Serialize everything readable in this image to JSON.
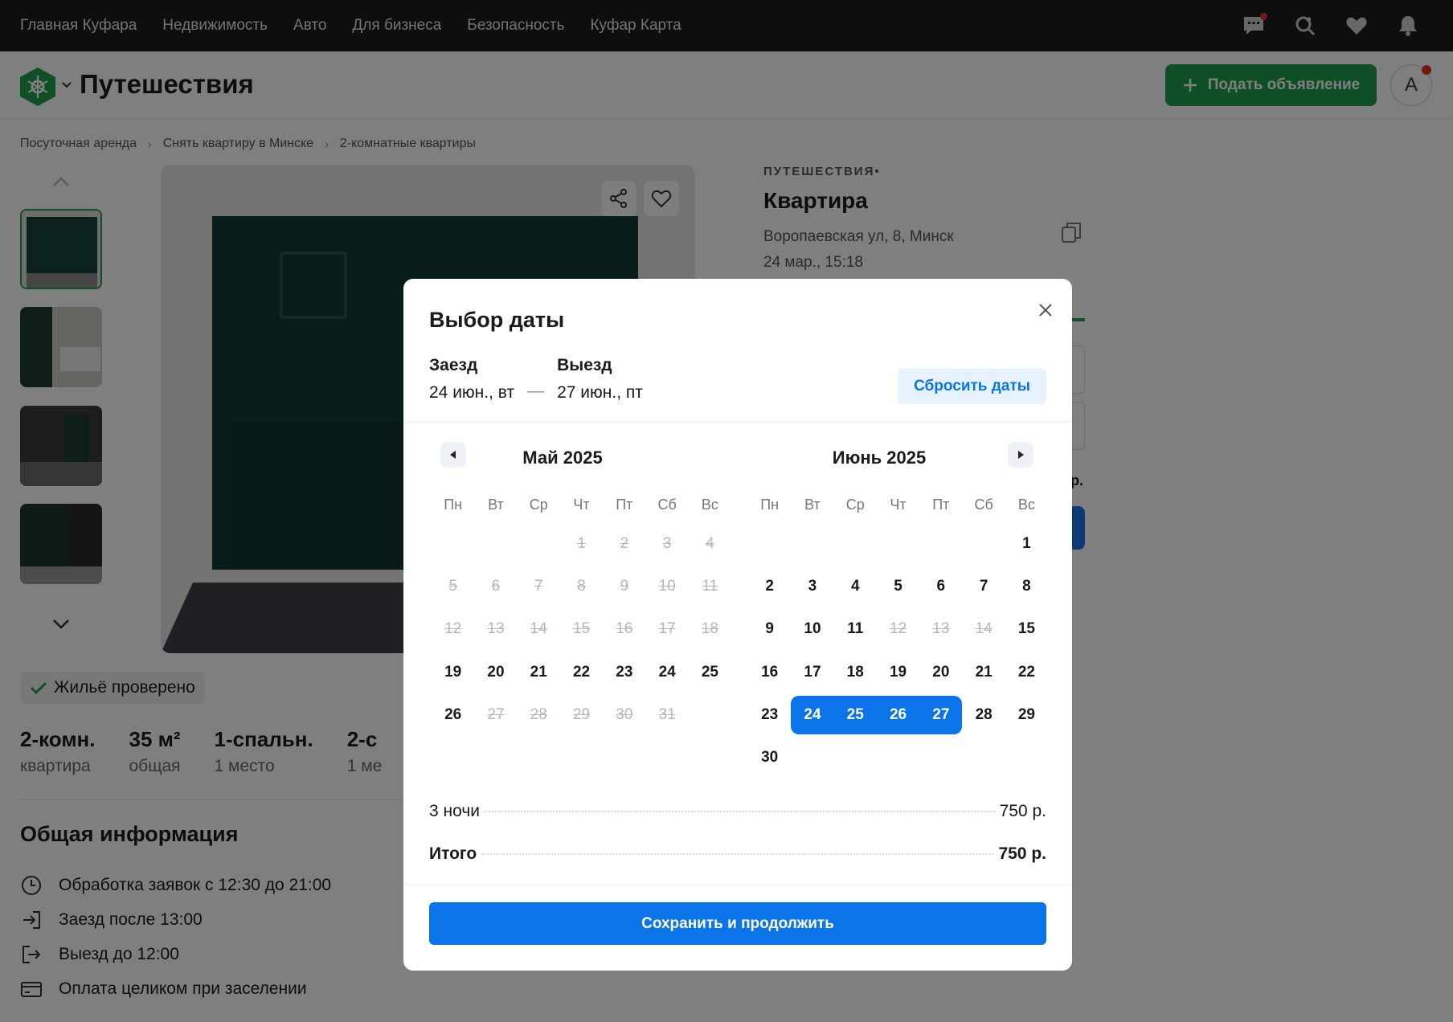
{
  "topnav": {
    "links": [
      "Главная Куфара",
      "Недвижимость",
      "Авто",
      "Для бизнеса",
      "Безопасность",
      "Куфар Карта"
    ]
  },
  "header": {
    "section_title": "Путешествия",
    "post_button": "Подать объявление",
    "avatar_letter": "А"
  },
  "breadcrumb": [
    "Посуточная аренда",
    "Снять квартиру в Минске",
    "2-комнатные квартиры"
  ],
  "listing": {
    "category": "ПУТЕШЕСТВИЯ•",
    "title": "Квартира",
    "address": "Воропаевская ул, 8, Минск",
    "date": "24 мар., 15:18",
    "partial_price": "р.",
    "verified": "Жильё проверено",
    "stats": [
      {
        "value": "2-комн.",
        "label": "квартира"
      },
      {
        "value": "35 м²",
        "label": "общая"
      },
      {
        "value": "1-спальн.",
        "label": "1 место"
      },
      {
        "value": "2-с",
        "label": "1 ме"
      }
    ],
    "general_title": "Общая информация",
    "general": [
      {
        "icon": "clock-icon",
        "text": "Обработка заявок с 12:30 до 21:00"
      },
      {
        "icon": "checkin-icon",
        "text": "Заезд после 13:00"
      },
      {
        "icon": "checkout-icon",
        "text": "Выезд до 12:00"
      },
      {
        "icon": "card-icon",
        "text": "Оплата целиком при заселении"
      }
    ]
  },
  "modal": {
    "title": "Выбор даты",
    "checkin_label": "Заезд",
    "checkin_value": "24 июн., вт",
    "dash": "—",
    "checkout_label": "Выезд",
    "checkout_value": "27 июн., пт",
    "reset_button": "Сбросить даты",
    "weekdays": [
      "Пн",
      "Вт",
      "Ср",
      "Чт",
      "Пт",
      "Сб",
      "Вс"
    ],
    "months": [
      {
        "title": "Май 2025",
        "weeks": [
          [
            {
              "d": ""
            },
            {
              "d": ""
            },
            {
              "d": ""
            },
            {
              "d": "1",
              "s": "dis"
            },
            {
              "d": "2",
              "s": "dis"
            },
            {
              "d": "3",
              "s": "dis"
            },
            {
              "d": "4",
              "s": "dis"
            }
          ],
          [
            {
              "d": "5",
              "s": "dis"
            },
            {
              "d": "6",
              "s": "dis"
            },
            {
              "d": "7",
              "s": "dis"
            },
            {
              "d": "8",
              "s": "dis"
            },
            {
              "d": "9",
              "s": "dis"
            },
            {
              "d": "10",
              "s": "dis"
            },
            {
              "d": "11",
              "s": "dis"
            }
          ],
          [
            {
              "d": "12",
              "s": "dis"
            },
            {
              "d": "13",
              "s": "dis"
            },
            {
              "d": "14",
              "s": "dis"
            },
            {
              "d": "15",
              "s": "dis"
            },
            {
              "d": "16",
              "s": "dis"
            },
            {
              "d": "17",
              "s": "dis"
            },
            {
              "d": "18",
              "s": "dis"
            }
          ],
          [
            {
              "d": "19"
            },
            {
              "d": "20"
            },
            {
              "d": "21"
            },
            {
              "d": "22"
            },
            {
              "d": "23"
            },
            {
              "d": "24"
            },
            {
              "d": "25"
            }
          ],
          [
            {
              "d": "26"
            },
            {
              "d": "27",
              "s": "dis"
            },
            {
              "d": "28",
              "s": "dis"
            },
            {
              "d": "29",
              "s": "dis"
            },
            {
              "d": "30",
              "s": "dis"
            },
            {
              "d": "31",
              "s": "dis"
            },
            {
              "d": ""
            }
          ]
        ]
      },
      {
        "title": "Июнь 2025",
        "weeks": [
          [
            {
              "d": ""
            },
            {
              "d": ""
            },
            {
              "d": ""
            },
            {
              "d": ""
            },
            {
              "d": ""
            },
            {
              "d": ""
            },
            {
              "d": "1"
            }
          ],
          [
            {
              "d": "2"
            },
            {
              "d": "3"
            },
            {
              "d": "4"
            },
            {
              "d": "5"
            },
            {
              "d": "6"
            },
            {
              "d": "7"
            },
            {
              "d": "8"
            }
          ],
          [
            {
              "d": "9"
            },
            {
              "d": "10"
            },
            {
              "d": "11"
            },
            {
              "d": "12",
              "s": "dis"
            },
            {
              "d": "13",
              "s": "dis"
            },
            {
              "d": "14",
              "s": "dis"
            },
            {
              "d": "15"
            }
          ],
          [
            {
              "d": "16"
            },
            {
              "d": "17"
            },
            {
              "d": "18"
            },
            {
              "d": "19"
            },
            {
              "d": "20"
            },
            {
              "d": "21"
            },
            {
              "d": "22"
            }
          ],
          [
            {
              "d": "23"
            },
            {
              "d": "24",
              "s": "sel first"
            },
            {
              "d": "25",
              "s": "sel"
            },
            {
              "d": "26",
              "s": "sel"
            },
            {
              "d": "27",
              "s": "sel last"
            },
            {
              "d": "28"
            },
            {
              "d": "29"
            }
          ],
          [
            {
              "d": "30"
            },
            {
              "d": ""
            },
            {
              "d": ""
            },
            {
              "d": ""
            },
            {
              "d": ""
            },
            {
              "d": ""
            },
            {
              "d": ""
            }
          ]
        ]
      }
    ],
    "nights_label": "3 ночи",
    "nights_price": "750 р.",
    "total_label": "Итого",
    "total_price": "750 р.",
    "save_button": "Сохранить и продолжить"
  },
  "colors": {
    "accent": "#0a74e8",
    "brand_green": "#1e9e4a",
    "selected_day": "#0a74e8"
  }
}
